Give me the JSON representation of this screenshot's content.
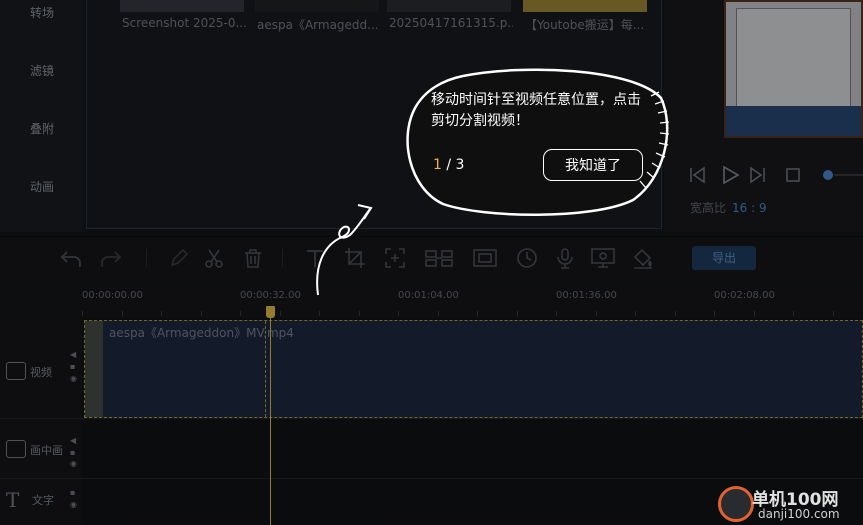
{
  "nav": {
    "items": [
      "转场",
      "滤镜",
      "叠附",
      "动画"
    ]
  },
  "media": {
    "items": [
      {
        "title": "Screenshot 2025-0..."
      },
      {
        "title": "aespa《Armagedd..."
      },
      {
        "title": "20250417161315.p..."
      },
      {
        "title": "【Youtobe搬运】每..."
      }
    ]
  },
  "preview": {
    "aspect_label": "宽高比",
    "aspect_value": "16 : 9"
  },
  "toolbar": {
    "export_label": "导出",
    "icons": [
      "undo-icon",
      "redo-icon",
      "pen-icon",
      "scissors-icon",
      "trash-icon",
      "text-icon",
      "crop-icon",
      "frame-icon",
      "split-screen-icon",
      "mosaic-icon",
      "speed-icon",
      "microphone-icon",
      "record-icon",
      "fill-icon"
    ]
  },
  "ruler": {
    "ticks": [
      "00:00:00.00",
      "00:00:32.00",
      "00:01:04.00",
      "00:01:36.00",
      "00:02:08.00"
    ]
  },
  "tracks": {
    "video_label": "视频",
    "pip_label": "画中画",
    "text_label": "文字",
    "clip_title": "aespa《Armageddon》MV.mp4"
  },
  "tooltip": {
    "message": "移动时间针至视频任意位置，点击剪切分割视频！",
    "step_current": "1",
    "step_sep": " / ",
    "step_total": "3",
    "button_label": "我知道了"
  },
  "watermark": {
    "name": "单机100网",
    "url": "danji100.com"
  },
  "colors": {
    "accent": "#f2c94c",
    "export_bg": "#1f3f66",
    "aspect_value": "#4f8fd8",
    "step_current": "#f2b03d",
    "watermark_ring": "#e0632d"
  }
}
